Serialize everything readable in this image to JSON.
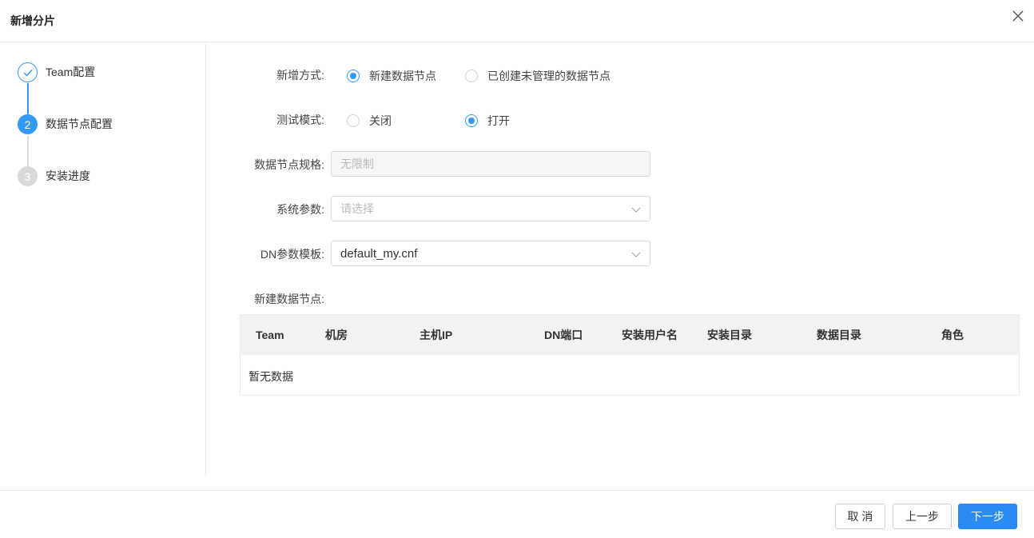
{
  "dialog": {
    "title": "新增分片"
  },
  "steps": [
    {
      "label": "Team配置",
      "number": "1",
      "state": "done"
    },
    {
      "label": "数据节点配置",
      "number": "2",
      "state": "active"
    },
    {
      "label": "安装进度",
      "number": "3",
      "state": "pending"
    }
  ],
  "form": {
    "add_mode": {
      "label": "新增方式:",
      "options": [
        "新建数据节点",
        "已创建未管理的数据节点"
      ],
      "selected": "新建数据节点"
    },
    "test_mode": {
      "label": "测试模式:",
      "options": [
        "关闭",
        "打开"
      ],
      "selected": "打开"
    },
    "node_spec": {
      "label": "数据节点规格:",
      "value": "无限制"
    },
    "sys_params": {
      "label": "系统参数:",
      "placeholder": "请选择"
    },
    "dn_template": {
      "label": "DN参数模板:",
      "value": "default_my.cnf"
    },
    "new_nodes_label": "新建数据节点:"
  },
  "table": {
    "columns": [
      "Team",
      "机房",
      "主机IP",
      "DN端口",
      "安装用户名",
      "安装目录",
      "数据目录",
      "角色"
    ],
    "empty_text": "暂无数据"
  },
  "footer": {
    "cancel_label": "取 消",
    "prev_label": "上一步",
    "next_label": "下一步"
  },
  "colors": {
    "primary": "#2a8cf2",
    "step_blue": "#3399f3"
  }
}
